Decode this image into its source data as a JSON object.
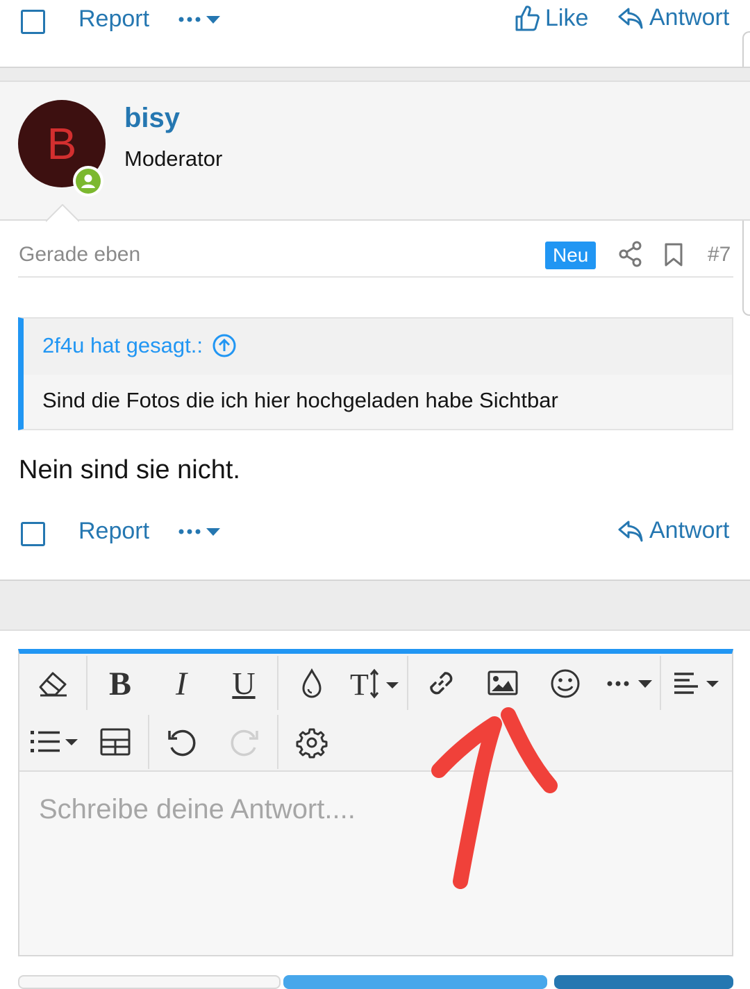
{
  "top_actions": {
    "report": "Report",
    "like": "Like",
    "reply": "Antwort"
  },
  "post": {
    "avatar_letter": "B",
    "username": "bisy",
    "role": "Moderator",
    "time": "Gerade eben",
    "badge": "Neu",
    "number": "#7",
    "quote": {
      "author": "2f4u hat gesagt.:",
      "text": "Sind die Fotos die ich hier hochgeladen habe Sichtbar"
    },
    "body": "Nein sind sie nicht.",
    "actions": {
      "report": "Report",
      "reply": "Antwort"
    }
  },
  "editor": {
    "placeholder": "Schreibe deine Antwort....",
    "toolbar_row1": [
      "eraser-icon",
      "bold-icon",
      "italic-icon",
      "underline-icon",
      "text-color-icon",
      "font-size-icon",
      "link-icon",
      "image-icon",
      "smiley-icon",
      "more-icon",
      "align-icon"
    ],
    "toolbar_row2": [
      "list-icon",
      "table-icon",
      "undo-icon",
      "redo-icon",
      "settings-icon"
    ]
  },
  "colors": {
    "accent": "#2577b1",
    "badge_bg": "#2196f3",
    "avatar_bg": "#3d1010",
    "avatar_letter": "#d32f2f",
    "online": "#7cb82f",
    "annotation_red": "#f0413a"
  }
}
